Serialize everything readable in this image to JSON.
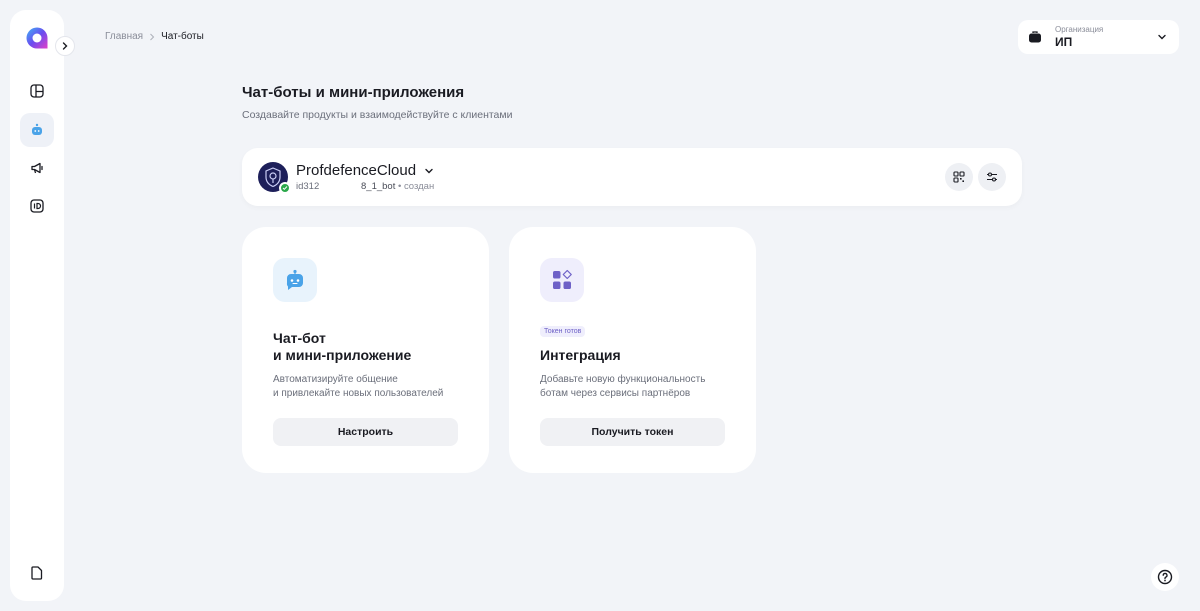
{
  "breadcrumb": {
    "home": "Главная",
    "current": "Чат-боты"
  },
  "org": {
    "label": "Организация",
    "value": "ИП"
  },
  "header": {
    "title": "Чат-боты и мини-приложения",
    "subtitle": "Создавайте продукты и взаимодействуйте с клиентами"
  },
  "bot": {
    "name": "ProfdefenceCloud",
    "id": "id312",
    "username": "8_1_bot",
    "status": "• создан"
  },
  "features": {
    "chatbot": {
      "title_line1": "Чат-бот",
      "title_line2": "и мини-приложение",
      "desc_line1": "Автоматизируйте общение",
      "desc_line2": "и привлекайте новых пользователей",
      "button": "Настроить"
    },
    "integration": {
      "badge": "Токен готов",
      "title": "Интеграция",
      "desc_line1": "Добавьте новую функциональность",
      "desc_line2": "ботам через сервисы партнёров",
      "button": "Получить токен"
    }
  },
  "colors": {
    "background": "#f2f4f8",
    "accent": "#6e61c7",
    "success": "#2ba84a",
    "bot_icon": "#4aa3e8"
  },
  "icons": {
    "logo": "app-logo-icon",
    "sidebar": [
      "dashboard-icon",
      "chatbot-icon",
      "megaphone-icon",
      "id-card-icon",
      "document-icon"
    ]
  }
}
